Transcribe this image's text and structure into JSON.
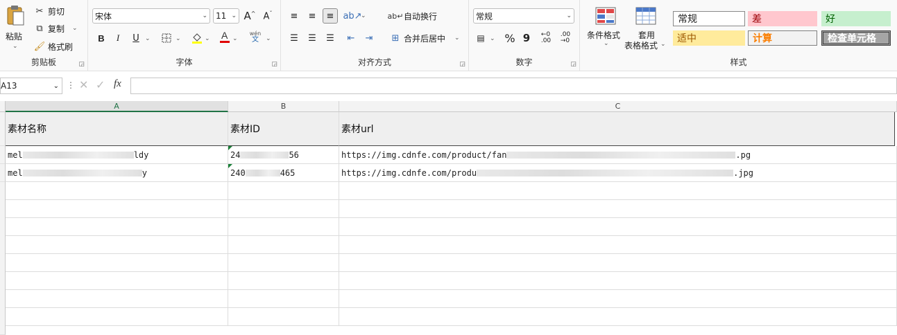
{
  "ribbon": {
    "clipboard": {
      "paste": "粘贴",
      "cut": "剪切",
      "copy": "复制",
      "format_painter": "格式刷",
      "label": "剪贴板"
    },
    "font": {
      "font_name": "宋体",
      "font_size": "11",
      "bold": "B",
      "italic": "I",
      "underline": "U",
      "grow": "A",
      "shrink": "A",
      "wen": "wén",
      "wen_sub": "文",
      "font_color_letter": "A",
      "label": "字体"
    },
    "alignment": {
      "wrap_text": "自动换行",
      "merge_center": "合并后居中",
      "label": "对齐方式"
    },
    "number": {
      "format": "常规",
      "percent": "%",
      "comma": "9",
      "label": "数字"
    },
    "styles_group": {
      "conditional_format": "条件格式",
      "table_format_line1": "套用",
      "table_format_line2": "表格格式",
      "normal": "常规",
      "bad": "差",
      "good": "好",
      "neutral": "适中",
      "calculation": "计算",
      "check_cell": "检查单元格",
      "label": "样式"
    }
  },
  "formula_bar": {
    "name_box": "A13",
    "fx": "fx"
  },
  "grid": {
    "columns": [
      "A",
      "B",
      "C"
    ],
    "headers": [
      "素材名称",
      "素材ID",
      "素材url"
    ],
    "rows": [
      {
        "a_start": "mel",
        "a_end": "ldy",
        "b_start": "24",
        "b_end": "56",
        "c_start": "https://img.cdnfe.com/product/fan",
        "c_end": "pg"
      },
      {
        "a_start": "mel",
        "a_end": "y",
        "b_start": "240",
        "b_end": "465",
        "c_start": "https://img.cdnfe.com/produ",
        "c_end": "jpg"
      }
    ]
  },
  "colors": {
    "excel_green": "#217346",
    "bad_fill": "#ffc7ce",
    "good_fill": "#c6efce",
    "neutral_fill": "#ffeb9c",
    "calc_fill": "#f2f2f2",
    "check_fill": "#a5a5a5"
  }
}
